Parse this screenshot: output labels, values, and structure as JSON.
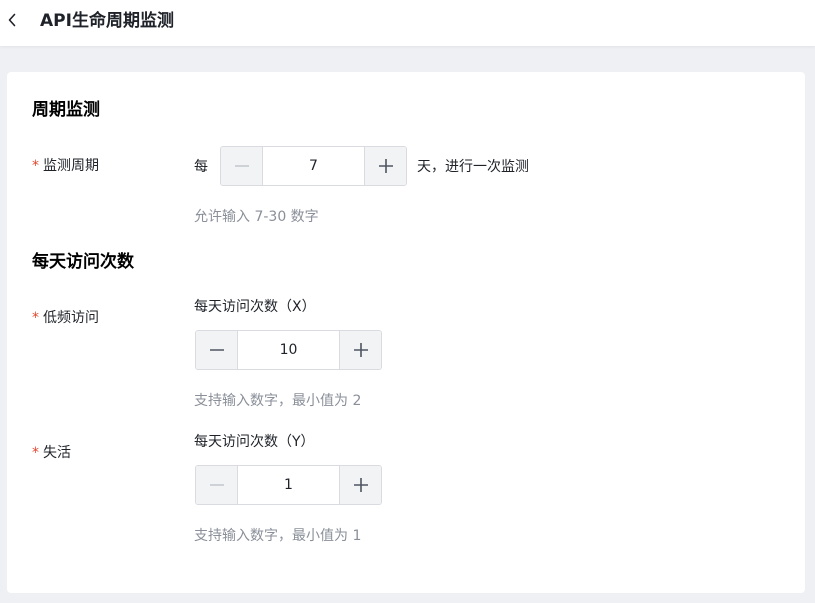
{
  "header": {
    "title": "API生命周期监测"
  },
  "period_section": {
    "title": "周期监测",
    "field_label": "监测周期",
    "prefix": "每",
    "value": "7",
    "suffix": "天，进行一次监测",
    "hint": "允许输入 7-30 数字"
  },
  "visits_section": {
    "title": "每天访问次数",
    "low_freq": {
      "label": "低频访问",
      "caption": "每天访问次数（X）",
      "value": "10",
      "hint": "支持输入数字，最小值为 2"
    },
    "inactive": {
      "label": "失活",
      "caption": "每天访问次数（Y）",
      "value": "1",
      "hint": "支持输入数字，最小值为 1"
    }
  },
  "required_mark": "*",
  "colors": {
    "required": "#e4472f",
    "hint": "#8a8f99",
    "stepper_button_bg": "#f2f3f5",
    "icon_active": "#4e5561",
    "icon_disabled": "#c2c6cc"
  },
  "icons": {
    "back": "chevron-left-icon",
    "minus": "minus-icon",
    "plus": "plus-icon"
  }
}
